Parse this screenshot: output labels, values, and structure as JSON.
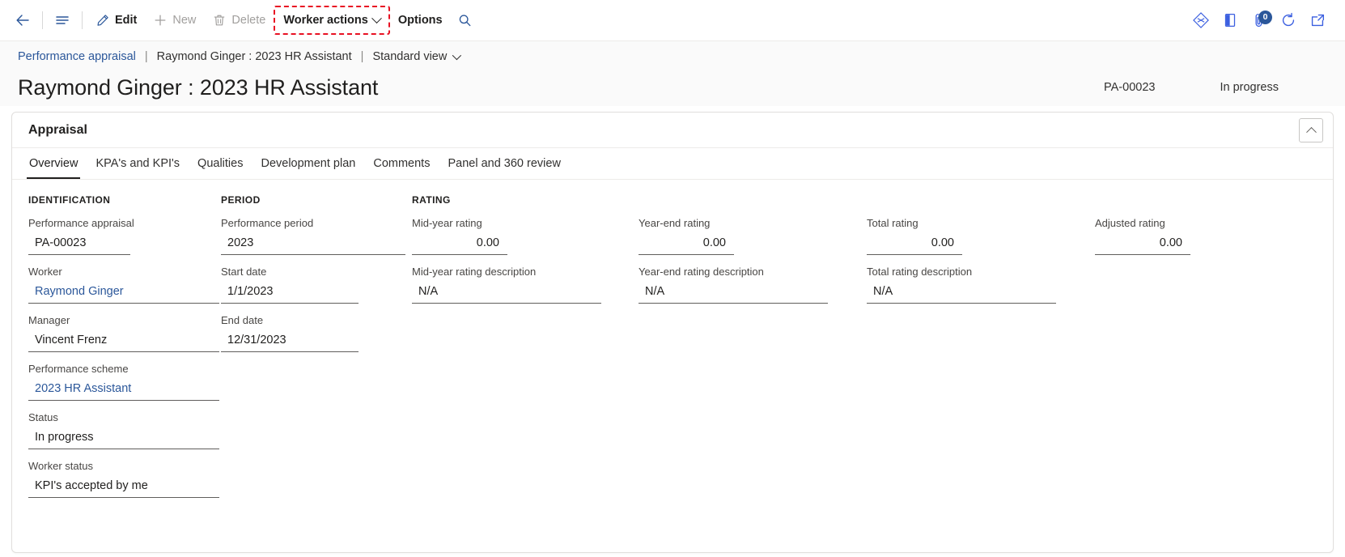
{
  "commandbar": {
    "back_icon": "arrow-left-icon",
    "menu_icon": "hamburger-icon",
    "edit_label": "Edit",
    "edit_icon": "pencil-icon",
    "new_label": "New",
    "new_icon": "plus-icon",
    "delete_label": "Delete",
    "delete_icon": "trash-icon",
    "worker_actions_label": "Worker actions",
    "options_label": "Options",
    "search_icon": "search-icon",
    "right_icons": [
      {
        "name": "dynamics-diamond-icon",
        "label": ""
      },
      {
        "name": "office-book-icon",
        "label": ""
      },
      {
        "name": "attachments-icon",
        "label": "",
        "badge": "0"
      },
      {
        "name": "refresh-icon",
        "label": ""
      },
      {
        "name": "open-in-new-icon",
        "label": ""
      }
    ],
    "highlight_color": "#e81123"
  },
  "breadcrumb": {
    "root": "Performance appraisal",
    "separator": "|",
    "current": "Raymond Ginger : 2023 HR Assistant",
    "view": "Standard view"
  },
  "header": {
    "title": "Raymond Ginger : 2023 HR Assistant",
    "record_id": "PA-00023",
    "status": "In progress"
  },
  "card": {
    "title": "Appraisal",
    "collapse_icon": "chevron-up-icon"
  },
  "tabs": [
    {
      "label": "Overview",
      "active": true
    },
    {
      "label": "KPA's and KPI's",
      "active": false
    },
    {
      "label": "Qualities",
      "active": false
    },
    {
      "label": "Development plan",
      "active": false
    },
    {
      "label": "Comments",
      "active": false
    },
    {
      "label": "Panel and 360 review",
      "active": false
    }
  ],
  "sections": {
    "identification": {
      "heading": "IDENTIFICATION",
      "fields": [
        {
          "label": "Performance appraisal",
          "value": "PA-00023",
          "link": false
        },
        {
          "label": "Worker",
          "value": "Raymond Ginger",
          "link": true
        },
        {
          "label": "Manager",
          "value": "Vincent Frenz",
          "link": false
        },
        {
          "label": "Performance scheme",
          "value": "2023 HR Assistant",
          "link": true
        },
        {
          "label": "Status",
          "value": "In progress",
          "link": false
        },
        {
          "label": "Worker status",
          "value": "KPI's accepted by me",
          "link": false
        }
      ]
    },
    "period": {
      "heading": "PERIOD",
      "fields": [
        {
          "label": "Performance period",
          "value": "2023"
        },
        {
          "label": "Start date",
          "value": "1/1/2023"
        },
        {
          "label": "End date",
          "value": "12/31/2023"
        }
      ]
    },
    "rating": {
      "heading": "RATING",
      "columns": [
        {
          "rating_label": "Mid-year rating",
          "rating_value": "0.00",
          "desc_label": "Mid-year rating description",
          "desc_value": "N/A"
        },
        {
          "rating_label": "Year-end rating",
          "rating_value": "0.00",
          "desc_label": "Year-end rating description",
          "desc_value": "N/A"
        },
        {
          "rating_label": "Total rating",
          "rating_value": "0.00",
          "desc_label": "Total rating description",
          "desc_value": "N/A"
        },
        {
          "rating_label": "Adjusted rating",
          "rating_value": "0.00",
          "desc_label": "",
          "desc_value": ""
        }
      ]
    }
  }
}
